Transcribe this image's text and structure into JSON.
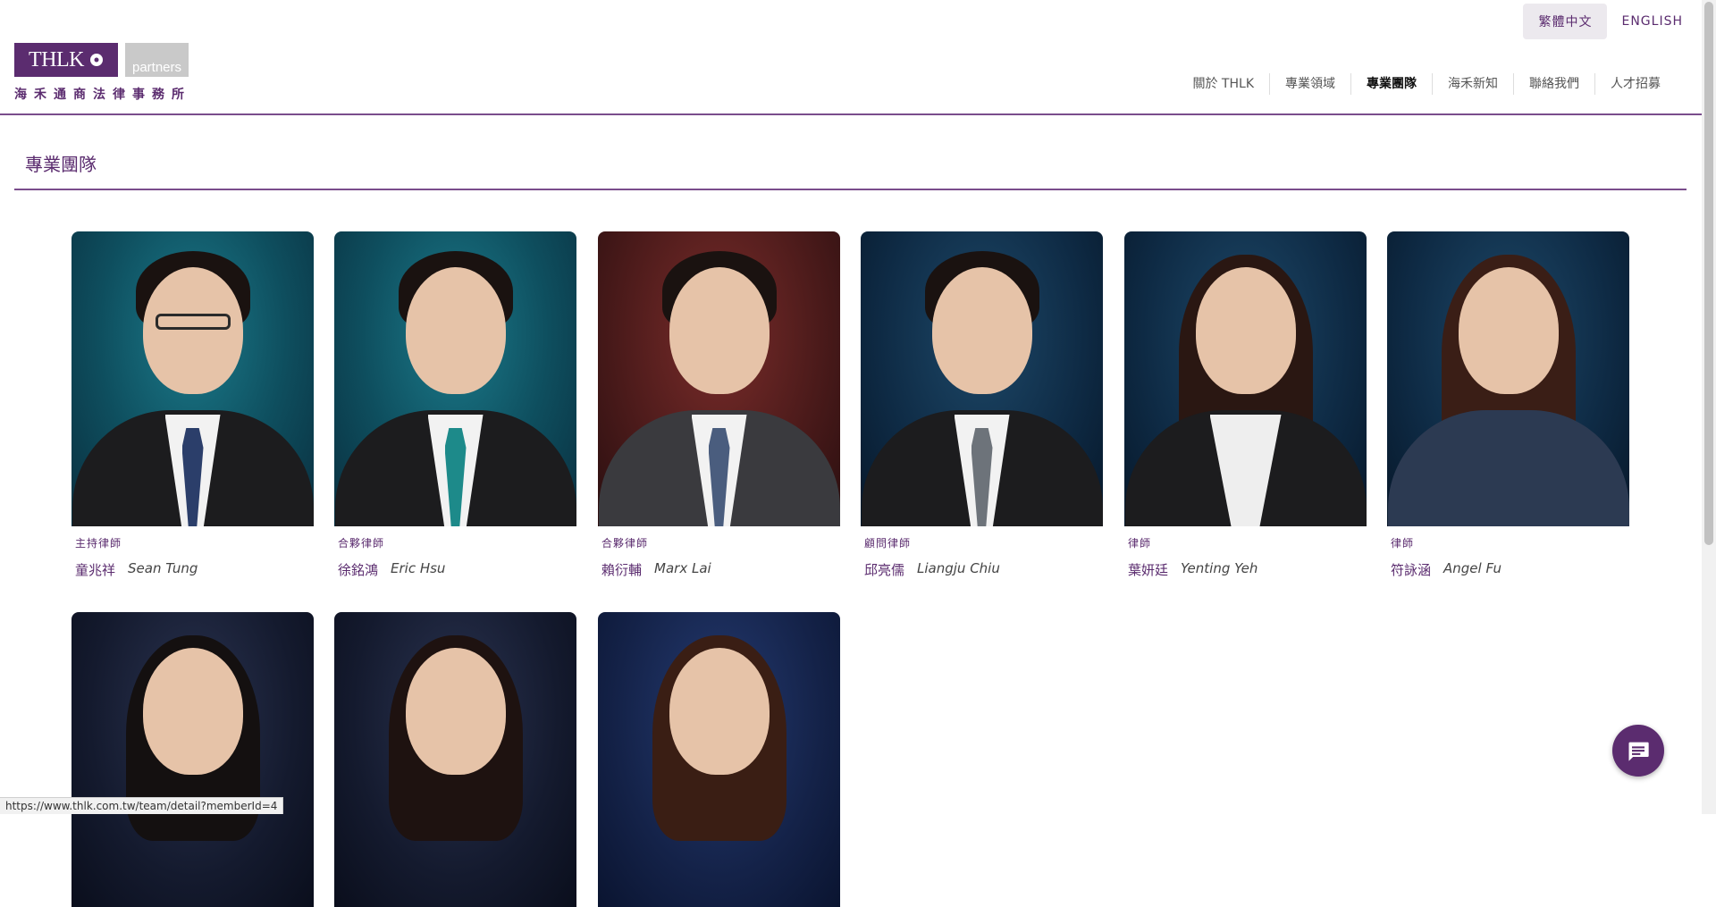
{
  "language": {
    "current": "繁體中文",
    "other": "ENGLISH"
  },
  "logo": {
    "brand": "THLK",
    "partners": "partners",
    "chinese_name": "海禾通商法律事務所"
  },
  "nav": {
    "items": [
      {
        "label": "關於 THLK",
        "active": false
      },
      {
        "label": "專業領域",
        "active": false
      },
      {
        "label": "專業團隊",
        "active": true
      },
      {
        "label": "海禾新知",
        "active": false
      },
      {
        "label": "聯絡我們",
        "active": false
      },
      {
        "label": "人才招募",
        "active": false
      }
    ]
  },
  "page": {
    "title": "專業團隊"
  },
  "team": [
    {
      "role": "主持律師",
      "name_zh": "童兆祥",
      "name_en": "Sean Tung"
    },
    {
      "role": "合夥律師",
      "name_zh": "徐銘鴻",
      "name_en": "Eric Hsu"
    },
    {
      "role": "合夥律師",
      "name_zh": "賴衍輔",
      "name_en": "Marx Lai"
    },
    {
      "role": "顧問律師",
      "name_zh": "邱亮儒",
      "name_en": "Liangju Chiu"
    },
    {
      "role": "律師",
      "name_zh": "葉妍廷",
      "name_en": "Yenting Yeh"
    },
    {
      "role": "律師",
      "name_zh": "符詠涵",
      "name_en": "Angel Fu"
    }
  ],
  "status_bar": {
    "url": "https://www.thlk.com.tw/team/detail?memberId=4"
  },
  "colors": {
    "brand_purple": "#5b2c6f",
    "rule": "#7a4d8c"
  },
  "icons": {
    "chat": "chat-bubble-icon",
    "logo_mark": "flower-icon"
  }
}
